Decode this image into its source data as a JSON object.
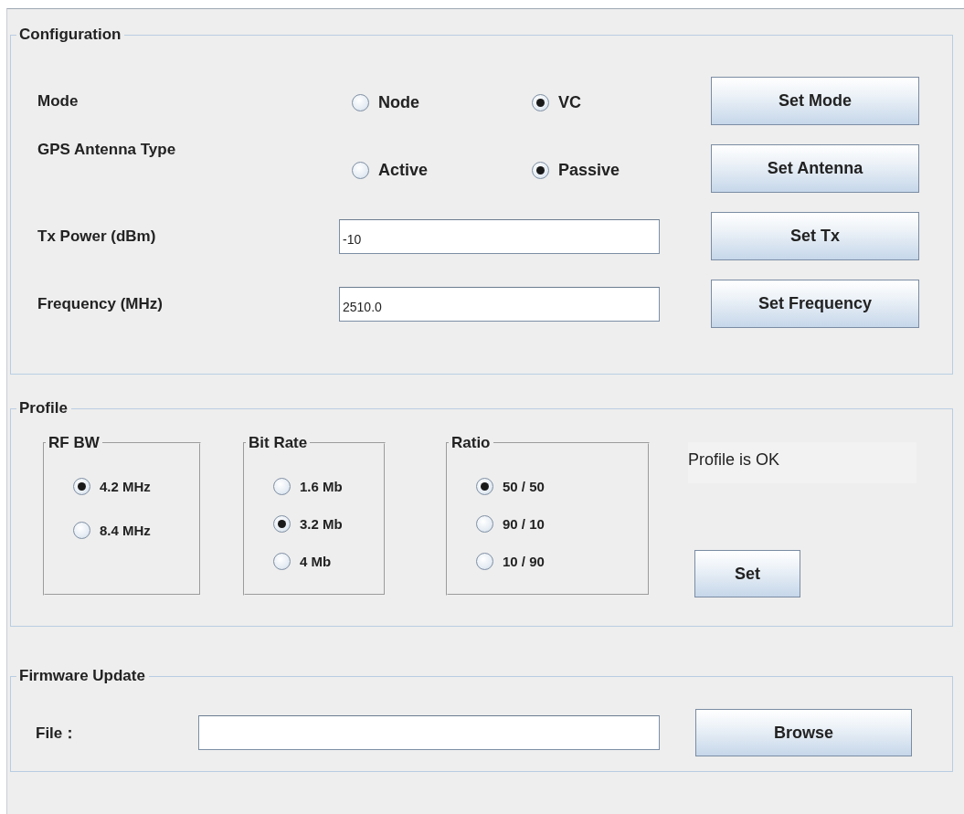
{
  "configuration": {
    "title": "Configuration",
    "rows": [
      {
        "kind": "radio",
        "label": "Mode",
        "options": [
          {
            "label": "Node",
            "selected": false
          },
          {
            "label": "VC",
            "selected": true
          }
        ],
        "button": "Set Mode"
      },
      {
        "kind": "radio",
        "label": "GPS Antenna Type",
        "options": [
          {
            "label": "Active",
            "selected": false
          },
          {
            "label": "Passive",
            "selected": true
          }
        ],
        "button": "Set Antenna"
      },
      {
        "kind": "field",
        "label": "Tx Power (dBm)",
        "value": "-10",
        "button": "Set Tx"
      },
      {
        "kind": "field",
        "label": "Frequency (MHz)",
        "value": "2510.0",
        "button": "Set Frequency"
      }
    ]
  },
  "profile": {
    "title": "Profile",
    "groups": [
      {
        "title": "RF BW",
        "options": [
          {
            "label": "4.2 MHz",
            "selected": true
          },
          {
            "label": "8.4 MHz",
            "selected": false
          }
        ]
      },
      {
        "title": "Bit Rate",
        "options": [
          {
            "label": "1.6 Mb",
            "selected": false
          },
          {
            "label": "3.2 Mb",
            "selected": true
          },
          {
            "label": "4 Mb",
            "selected": false
          }
        ]
      },
      {
        "title": "Ratio",
        "options": [
          {
            "label": "50 / 50",
            "selected": true
          },
          {
            "label": "90 / 10",
            "selected": false
          },
          {
            "label": "10 / 90",
            "selected": false
          }
        ]
      }
    ],
    "status": "Profile is OK",
    "button": "Set"
  },
  "firmware_update": {
    "title": "Firmware Update",
    "label": "File：",
    "button": "Browse"
  }
}
